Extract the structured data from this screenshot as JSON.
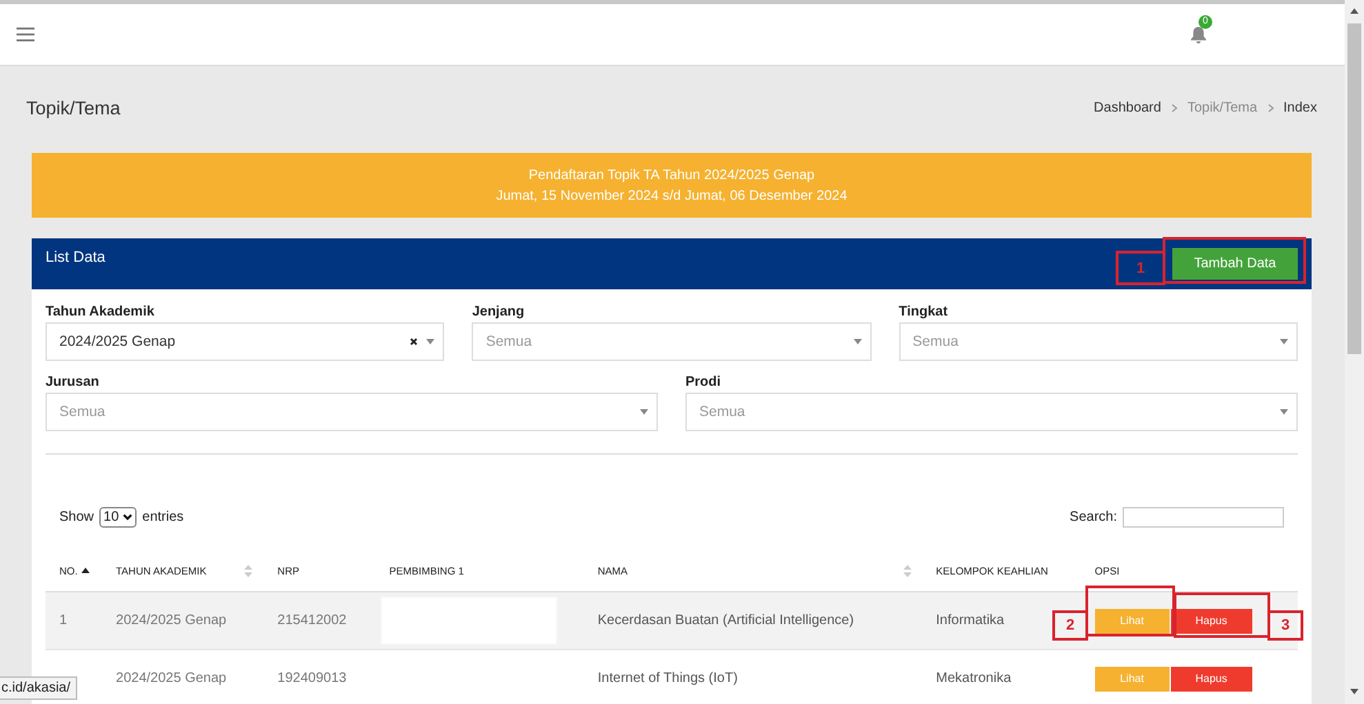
{
  "topbar": {
    "notification_count": "0"
  },
  "page": {
    "title": "Topik/Tema",
    "breadcrumb": [
      {
        "label": "Dashboard",
        "kind": "link"
      },
      {
        "label": "Topik/Tema",
        "kind": "muted"
      },
      {
        "label": "Index",
        "kind": "current"
      }
    ]
  },
  "banner": {
    "lines": [
      "Pendaftaran Topik TA Tahun 2024/2025 Genap",
      "Jumat, 15 November 2024 s/d Jumat, 06 Desember 2024"
    ]
  },
  "card": {
    "title": "List Data",
    "add_button": "Tambah Data"
  },
  "filters": [
    {
      "label": "Tahun Akademik",
      "value": "2024/2025 Genap",
      "clearable": true
    },
    {
      "label": "Jenjang",
      "placeholder": "Semua",
      "clearable": false
    },
    {
      "label": "Tingkat",
      "placeholder": "Semua",
      "clearable": false
    },
    {
      "label": "Jurusan",
      "placeholder": "Semua",
      "clearable": false
    },
    {
      "label": "Prodi",
      "placeholder": "Semua",
      "clearable": false
    }
  ],
  "table": {
    "show_label": "Show",
    "page_size": "10",
    "entries_label": "entries",
    "search_label": "Search:",
    "columns": [
      {
        "label": "NO.",
        "sortable": true,
        "sorted": true
      },
      {
        "label": "TAHUN AKADEMIK",
        "sortable": true,
        "sorted": false
      },
      {
        "label": "NRP",
        "sortable": false,
        "sorted": false
      },
      {
        "label": "PEMBIMBING 1",
        "sortable": false,
        "sorted": false
      },
      {
        "label": "NAMA",
        "sortable": true,
        "sorted": false
      },
      {
        "label": "KELOMPOK KEAHLIAN",
        "sortable": false,
        "sorted": false
      },
      {
        "label": "OPSI",
        "sortable": false,
        "sorted": false
      }
    ],
    "rows": [
      {
        "no": "1",
        "tahun": "2024/2025 Genap",
        "nrp": "215412002",
        "pembimbing_redacted": true,
        "nama": "Kecerdasan Buatan (Artificial Intelligence)",
        "kelompok": "Informatika",
        "actions": [
          "Lihat",
          "Hapus"
        ]
      },
      {
        "tahun": "2024/2025 Genap",
        "nrp": "192409013",
        "pembimbing_redacted": false,
        "nama": "Internet of Things (IoT)",
        "kelompok": "Mekatronika",
        "actions": [
          "Lihat",
          "Hapus"
        ]
      }
    ]
  },
  "annotations": [
    {
      "label": "1"
    },
    {
      "label": "2"
    },
    {
      "label": "3"
    }
  ],
  "status_url": "c.id/akasia/"
}
